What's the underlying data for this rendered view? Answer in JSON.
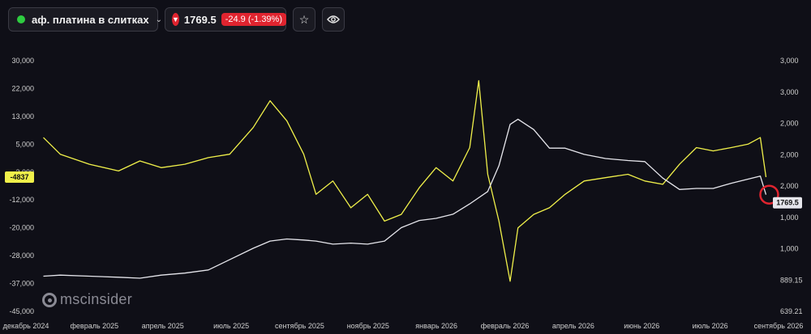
{
  "header": {
    "symbol": "аф. платина в слитках",
    "price": "1769.5",
    "change": "-24.9 (-1.39%)",
    "icons": [
      "status-dot-icon",
      "chevron-down-icon",
      "down-arrow-icon",
      "star-icon",
      "eye-icon"
    ],
    "colors": {
      "status": "#2ecc40",
      "down": "#e0242f"
    }
  },
  "logo": {
    "text": "mscinsider"
  },
  "chart_data": {
    "type": "line",
    "x_labels": [
      "декабрь 2024",
      "февраль 2025",
      "апрель 2025",
      "июль 2025",
      "сентябрь 2025",
      "ноябрь 2025",
      "январь 2026",
      "февраль 2026",
      "апрель 2026",
      "июнь 2026",
      "июль 2026",
      "сентябрь 2026"
    ],
    "left_axis": {
      "ticks": [
        "30,000",
        "22,000",
        "13,000",
        "5,000",
        "-3,000",
        "-12,000",
        "-20,000",
        "-28,000",
        "-37,000",
        "-45,000"
      ],
      "range": [
        -45000,
        30000
      ]
    },
    "right_axis": {
      "ticks": [
        "3,000",
        "3,000",
        "2,000",
        "2,000",
        "2,000",
        "1,000",
        "1,000",
        "889.15",
        "639.21"
      ]
    },
    "left_last_label": "-4837",
    "right_last_label": "1769.5",
    "grid": false,
    "series": [
      {
        "axis": "left",
        "color": "#f0f04a",
        "x": [
          "2024-12-05",
          "2024-12-20",
          "2025-01-15",
          "2025-02-10",
          "2025-03-01",
          "2025-03-20",
          "2025-04-10",
          "2025-05-01",
          "2025-05-20",
          "2025-06-10",
          "2025-06-25",
          "2025-07-10",
          "2025-07-25",
          "2025-08-05",
          "2025-08-20",
          "2025-09-05",
          "2025-09-20",
          "2025-10-05",
          "2025-10-20",
          "2025-11-05",
          "2025-11-20",
          "2025-12-05",
          "2025-12-20",
          "2025-12-28",
          "2026-01-05",
          "2026-01-15",
          "2026-01-25",
          "2026-02-01",
          "2026-02-15",
          "2026-03-01",
          "2026-03-15",
          "2026-04-01",
          "2026-04-20",
          "2026-05-10",
          "2026-05-25",
          "2026-06-10",
          "2026-06-25",
          "2026-07-10",
          "2026-07-25",
          "2026-08-10",
          "2026-08-25",
          "2026-09-05",
          "2026-09-10"
        ],
        "y": [
          7000,
          2000,
          -1000,
          -3000,
          0,
          -2000,
          -1000,
          1000,
          2000,
          10000,
          18000,
          12000,
          2000,
          -10000,
          -6000,
          -14000,
          -10000,
          -18000,
          -16000,
          -8000,
          -2000,
          -6000,
          4000,
          24000,
          -4000,
          -18000,
          -36000,
          -20000,
          -16000,
          -14000,
          -10000,
          -6000,
          -5000,
          -4000,
          -6000,
          -7000,
          -1000,
          4000,
          3000,
          4000,
          5000,
          7000,
          -4837
        ]
      },
      {
        "axis": "right",
        "color": "#e6e6ec",
        "x": [
          "2024-12-05",
          "2024-12-20",
          "2025-01-15",
          "2025-02-10",
          "2025-03-01",
          "2025-03-20",
          "2025-04-10",
          "2025-05-01",
          "2025-05-20",
          "2025-06-10",
          "2025-06-25",
          "2025-07-10",
          "2025-07-25",
          "2025-08-05",
          "2025-08-20",
          "2025-09-05",
          "2025-09-20",
          "2025-10-05",
          "2025-10-20",
          "2025-11-05",
          "2025-11-20",
          "2025-12-05",
          "2025-12-20",
          "2026-01-05",
          "2026-01-15",
          "2026-01-25",
          "2026-02-01",
          "2026-02-15",
          "2026-03-01",
          "2026-03-15",
          "2026-04-01",
          "2026-04-20",
          "2026-05-10",
          "2026-05-25",
          "2026-06-10",
          "2026-06-25",
          "2026-07-10",
          "2026-07-25",
          "2026-08-10",
          "2026-08-25",
          "2026-09-05",
          "2026-09-10"
        ],
        "y": [
          980,
          990,
          980,
          970,
          960,
          990,
          1010,
          1040,
          1140,
          1250,
          1320,
          1340,
          1330,
          1320,
          1290,
          1300,
          1290,
          1320,
          1450,
          1520,
          1540,
          1580,
          1680,
          1800,
          2050,
          2450,
          2500,
          2400,
          2220,
          2220,
          2160,
          2120,
          2100,
          2090,
          1930,
          1820,
          1830,
          1830,
          1880,
          1920,
          1950,
          1769.5
        ]
      }
    ]
  }
}
